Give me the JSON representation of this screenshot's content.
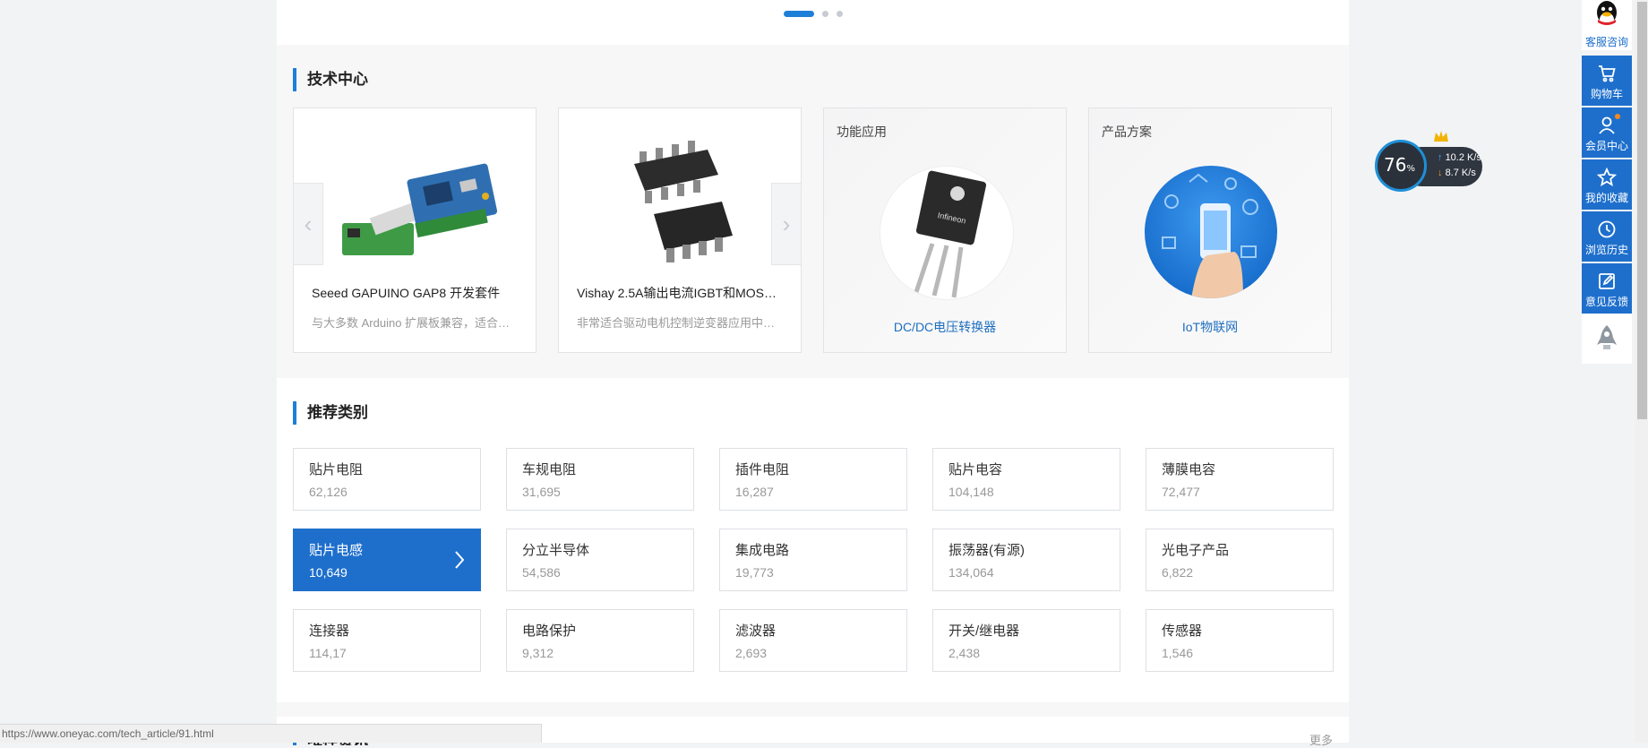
{
  "carousel": {
    "active_index": 0,
    "dot_count": 3
  },
  "tech_center": {
    "title": "技术中心",
    "cards": [
      {
        "title": "Seeed GAPUINO GAP8 开发套件",
        "desc": "与大多数 Arduino 扩展板兼容，适合…"
      },
      {
        "title": "Vishay 2.5A输出电流IGBT和MOSF…",
        "desc": "非常适合驱动电机控制逆变器应用中…"
      },
      {
        "tag": "功能应用",
        "link": "DC/DC电压转换器"
      },
      {
        "tag": "产品方案",
        "link": "IoT物联网"
      }
    ],
    "prev_arrow": "‹",
    "next_arrow": "›"
  },
  "recommend": {
    "title": "推荐类别",
    "categories": [
      {
        "name": "贴片电阻",
        "count": "62,126"
      },
      {
        "name": "车规电阻",
        "count": "31,695"
      },
      {
        "name": "插件电阻",
        "count": "16,287"
      },
      {
        "name": "贴片电容",
        "count": "104,148"
      },
      {
        "name": "薄膜电容",
        "count": "72,477"
      },
      {
        "name": "贴片电感",
        "count": "10,649",
        "active": true
      },
      {
        "name": "分立半导体",
        "count": "54,586"
      },
      {
        "name": "集成电路",
        "count": "19,773"
      },
      {
        "name": "振荡器(有源)",
        "count": "134,064"
      },
      {
        "name": "光电子产品",
        "count": "6,822"
      },
      {
        "name": "连接器",
        "count": "114,17"
      },
      {
        "name": "电路保护",
        "count": "9,312"
      },
      {
        "name": "滤波器",
        "count": "2,693"
      },
      {
        "name": "开关/继电器",
        "count": "2,438"
      },
      {
        "name": "传感器",
        "count": "1,546"
      }
    ]
  },
  "news": {
    "title": "唯样资讯",
    "more": "更多"
  },
  "sidebar": {
    "qq_label": "客服咨询",
    "cart": "购物车",
    "member": "会员中心",
    "favorites": "我的收藏",
    "history": "浏览历史",
    "feedback": "意见反馈"
  },
  "speed_widget": {
    "percent": "76",
    "percent_unit": "%",
    "up": "10.2",
    "up_unit": "K/s",
    "down": "8.7",
    "down_unit": "K/s"
  },
  "status_bar": {
    "url": "https://www.oneyac.com/tech_article/91.html"
  },
  "colors": {
    "accent": "#1e6fcc",
    "title_bar": "#1e7fd8"
  }
}
